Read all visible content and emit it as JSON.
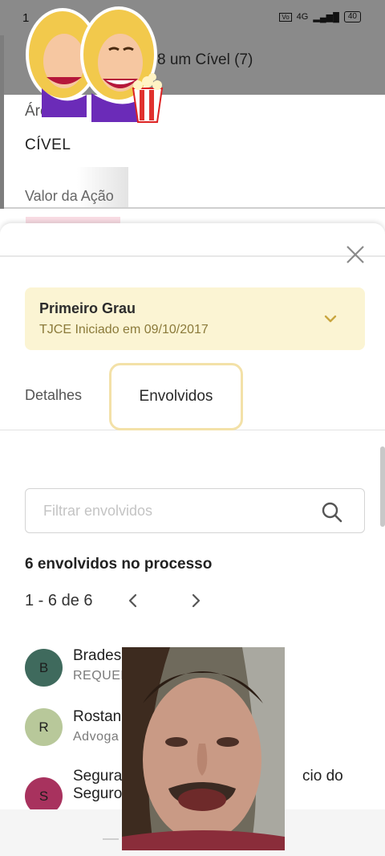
{
  "status_bar": {
    "time": "1",
    "network": "4G",
    "battery": "40"
  },
  "header": {
    "title": "8 um Cível (7)"
  },
  "background_details": {
    "area_label": "Área",
    "area_value": "CÍVEL",
    "valor_label": "Valor da Ação"
  },
  "sheet": {
    "grau": {
      "title": "Primeiro Grau",
      "subtitle": "TJCE Iniciado em 09/10/2017"
    },
    "tabs": [
      {
        "label": "Detalhes"
      },
      {
        "label": "Envolvidos",
        "active": true
      }
    ],
    "search": {
      "placeholder": "Filtrar envolvidos",
      "value": ""
    },
    "count_text": "6 envolvidos no processo",
    "pager": {
      "range": "1 - 6 de 6"
    },
    "parties": [
      {
        "initial": "B",
        "name": "Brades",
        "role": "REQUEF",
        "avatar_color": "#3f6a5d"
      },
      {
        "initial": "R",
        "name": "Rostan",
        "role": "Advoga",
        "avatar_color": "#b8c89a"
      },
      {
        "initial": "S",
        "name": "Segura",
        "name_suffix": "cio do",
        "name_line2": "Seguro",
        "avatar_color": "#a8325e"
      }
    ]
  },
  "colors": {
    "grau_card_bg": "#fbf4d3",
    "tab_highlight": "#f3e1a8",
    "chevron": "#c9a640"
  }
}
